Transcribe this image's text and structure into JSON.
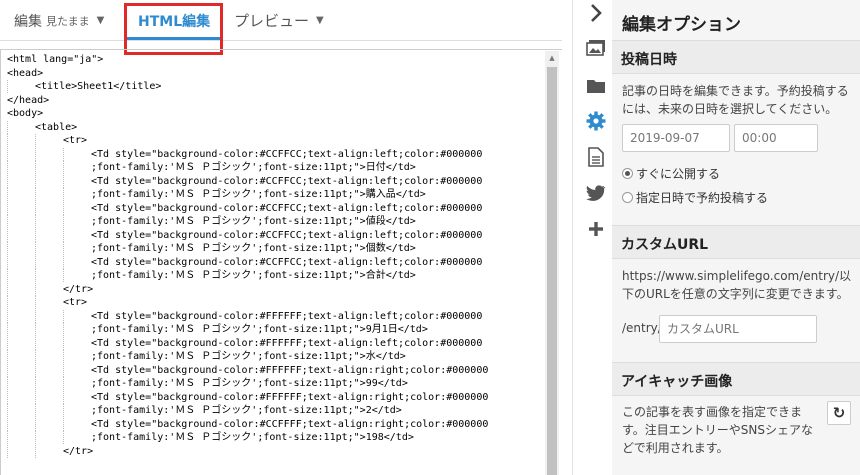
{
  "tabs": {
    "view": {
      "label": "編集",
      "sub": "見たまま"
    },
    "html": {
      "label": "HTML編集"
    },
    "preview": {
      "label": "プレビュー"
    }
  },
  "code_lines": [
    {
      "indent": 0,
      "text": "<html lang=\"ja\">"
    },
    {
      "indent": 0,
      "text": "<head>"
    },
    {
      "indent": 1,
      "text": "<title>Sheet1</title>"
    },
    {
      "indent": 0,
      "text": "</head>"
    },
    {
      "indent": 0,
      "text": "<body>"
    },
    {
      "indent": 1,
      "text": "<table>"
    },
    {
      "indent": 2,
      "text": "<tr>"
    },
    {
      "indent": 3,
      "text": "<Td style=\"background-color:#CCFFCC;text-align:left;color:#000000"
    },
    {
      "indent": 3,
      "text": ";font-family:'ＭＳ Ｐゴシック';font-size:11pt;\">日付</td>"
    },
    {
      "indent": 3,
      "text": "<Td style=\"background-color:#CCFFCC;text-align:left;color:#000000"
    },
    {
      "indent": 3,
      "text": ";font-family:'ＭＳ Ｐゴシック';font-size:11pt;\">購入品</td>"
    },
    {
      "indent": 3,
      "text": "<Td style=\"background-color:#CCFFCC;text-align:left;color:#000000"
    },
    {
      "indent": 3,
      "text": ";font-family:'ＭＳ Ｐゴシック';font-size:11pt;\">値段</td>"
    },
    {
      "indent": 3,
      "text": "<Td style=\"background-color:#CCFFCC;text-align:left;color:#000000"
    },
    {
      "indent": 3,
      "text": ";font-family:'ＭＳ Ｐゴシック';font-size:11pt;\">個数</td>"
    },
    {
      "indent": 3,
      "text": "<Td style=\"background-color:#CCFFCC;text-align:left;color:#000000"
    },
    {
      "indent": 3,
      "text": ";font-family:'ＭＳ Ｐゴシック';font-size:11pt;\">合計</td>"
    },
    {
      "indent": 2,
      "text": "</tr>"
    },
    {
      "indent": 2,
      "text": "<tr>"
    },
    {
      "indent": 3,
      "text": "<Td style=\"background-color:#FFFFFF;text-align:left;color:#000000"
    },
    {
      "indent": 3,
      "text": ";font-family:'ＭＳ Ｐゴシック';font-size:11pt;\">9月1日</td>"
    },
    {
      "indent": 3,
      "text": "<Td style=\"background-color:#FFFFFF;text-align:left;color:#000000"
    },
    {
      "indent": 3,
      "text": ";font-family:'ＭＳ Ｐゴシック';font-size:11pt;\">水</td>"
    },
    {
      "indent": 3,
      "text": "<Td style=\"background-color:#FFFFFF;text-align:right;color:#000000"
    },
    {
      "indent": 3,
      "text": ";font-family:'ＭＳ Ｐゴシック';font-size:11pt;\">99</td>"
    },
    {
      "indent": 3,
      "text": "<Td style=\"background-color:#FFFFFF;text-align:right;color:#000000"
    },
    {
      "indent": 3,
      "text": ";font-family:'ＭＳ Ｐゴシック';font-size:11pt;\">2</td>"
    },
    {
      "indent": 3,
      "text": "<Td style=\"background-color:#CCFFFF;text-align:right;color:#000000"
    },
    {
      "indent": 3,
      "text": ";font-family:'ＭＳ Ｐゴシック';font-size:11pt;\">198</td>"
    },
    {
      "indent": 2,
      "text": "</tr>"
    }
  ],
  "icons": [
    "chevron-right-icon",
    "image-icon",
    "folder-icon",
    "gear-icon",
    "document-icon",
    "twitter-icon",
    "plus-icon"
  ],
  "panel": {
    "title": "編集オプション",
    "post_date": {
      "heading": "投稿日時",
      "desc": "記事の日時を編集できます。予約投稿するには、未来の日時を選択してください。",
      "date": "2019-09-07",
      "time": "00:00",
      "radio_now": "すぐに公開する",
      "radio_schedule": "指定日時で予約投稿する"
    },
    "custom_url": {
      "heading": "カスタムURL",
      "desc": "https://www.simplelifego.com/entry/以下のURLを任意の文字列に変更できます。",
      "prefix": "/entry/",
      "placeholder": "カスタムURL"
    },
    "eyecatch": {
      "heading": "アイキャッチ画像",
      "desc": "この記事を表す画像を指定できます。注目エントリーやSNSシェアなどで利用されます。"
    }
  },
  "colors": {
    "accent": "#2e8bd0",
    "highlight": "#e02929",
    "panel_bg": "#f5f5f5"
  }
}
